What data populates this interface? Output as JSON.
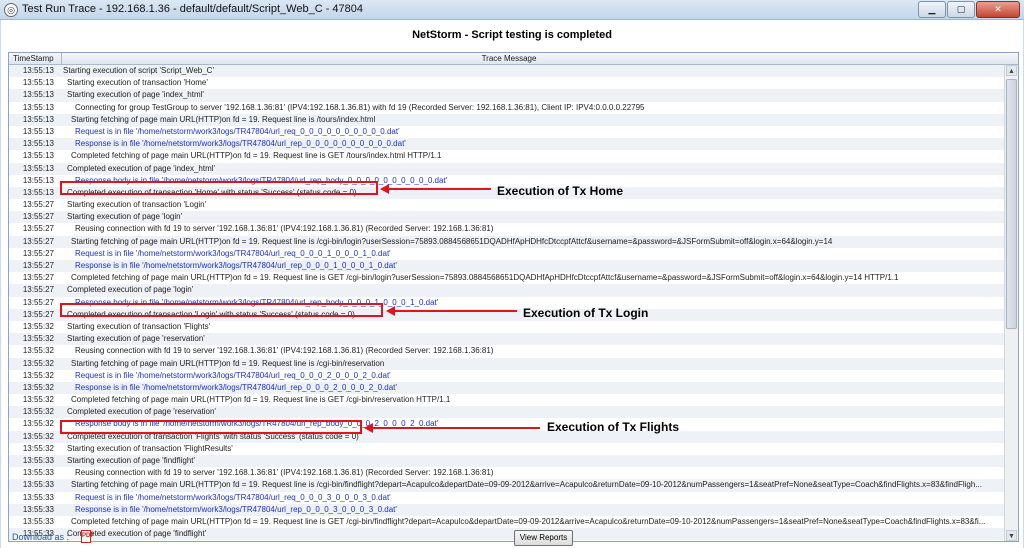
{
  "window": {
    "title": "Test Run Trace - 192.168.1.36 - default/default/Script_Web_C - 47804",
    "app_icon": "globe-icon",
    "controls": [
      "minimize-icon",
      "maximize-icon",
      "close-icon"
    ]
  },
  "heading": "NetStorm  -  Script testing is completed",
  "table": {
    "columns": {
      "timestamp": "TimeStamp",
      "message": "Trace Message"
    },
    "rows": [
      {
        "time": "13:55:13",
        "msg": "Starting execution of script 'Script_Web_C'",
        "indent": 0,
        "blue": false
      },
      {
        "time": "13:55:13",
        "msg": "Starting execution of transaction 'Home'",
        "indent": 1,
        "blue": false
      },
      {
        "time": "13:55:13",
        "msg": "Starting execution of page 'index_html'",
        "indent": 1,
        "blue": false
      },
      {
        "time": "13:55:13",
        "msg": "Connecting for group TestGroup to server '192.168.1.36:81' (IPV4:192.168.1.36.81) with fd 19 (Recorded Server: 192.168.1.36:81), Client IP: IPV4:0.0.0.0.22795",
        "indent": 3,
        "blue": false
      },
      {
        "time": "13:55:13",
        "msg": "Starting fetching of page main URL(HTTP)on fd = 19. Request line is /tours/index.html",
        "indent": 2,
        "blue": false
      },
      {
        "time": "13:55:13",
        "msg": "Request is in file '/home/netstorm/work3/logs/TR47804/url_req_0_0_0_0_0_0_0_0_0_0.dat'",
        "indent": 3,
        "blue": true
      },
      {
        "time": "13:55:13",
        "msg": "Response is in file '/home/netstorm/work3/logs/TR47804/url_rep_0_0_0_0_0_0_0_0_0_0.dat'",
        "indent": 3,
        "blue": true
      },
      {
        "time": "13:55:13",
        "msg": "Completed fetching of page main URL(HTTP)on fd = 19. Request line is GET /tours/index.html HTTP/1.1",
        "indent": 2,
        "blue": false
      },
      {
        "time": "13:55:13",
        "msg": "Completed execution of page 'index_html'",
        "indent": 1,
        "blue": false
      },
      {
        "time": "13:55:13",
        "msg": "Response body is in file '/home/netstorm/work3/logs/TR47804/url_rep_body_0_0_0_0_0_0_0_0_0_0.dat'",
        "indent": 3,
        "blue": true
      },
      {
        "time": "13:55:13",
        "msg": "Completed execution of transaction 'Home' with status 'Success' (status code = 0)",
        "indent": 1,
        "blue": false
      },
      {
        "time": "13:55:27",
        "msg": "Starting execution of transaction 'Login'",
        "indent": 1,
        "blue": false
      },
      {
        "time": "13:55:27",
        "msg": "Starting execution of page 'login'",
        "indent": 1,
        "blue": false
      },
      {
        "time": "13:55:27",
        "msg": "Reusing connection with fd 19 to server '192.168.1.36:81' (IPV4:192.168.1.36.81) (Recorded Server: 192.168.1.36:81)",
        "indent": 3,
        "blue": false
      },
      {
        "time": "13:55:27",
        "msg": "Starting fetching of page main URL(HTTP)on fd = 19. Request line is /cgi-bin/login?userSession=75893.0884568651DQADHfApHDHfcDtccpfAttcf&username=&password=&JSFormSubmit=off&login.x=64&login.y=14",
        "indent": 2,
        "blue": false
      },
      {
        "time": "13:55:27",
        "msg": "Request is in file '/home/netstorm/work3/logs/TR47804/url_req_0_0_0_1_0_0_0_1_0.dat'",
        "indent": 3,
        "blue": true
      },
      {
        "time": "13:55:27",
        "msg": "Response is in file '/home/netstorm/work3/logs/TR47804/url_rep_0_0_0_1_0_0_0_1_0.dat'",
        "indent": 3,
        "blue": true
      },
      {
        "time": "13:55:27",
        "msg": "Completed fetching of page main URL(HTTP)on fd = 19. Request line is GET /cgi-bin/login?userSession=75893.0884568651DQADHfApHDHfcDtccpfAttcf&username=&password=&JSFormSubmit=off&login.x=64&login.y=14 HTTP/1.1",
        "indent": 2,
        "blue": false
      },
      {
        "time": "13:55:27",
        "msg": "Completed execution of page 'login'",
        "indent": 1,
        "blue": false
      },
      {
        "time": "13:55:27",
        "msg": "Response body is in file '/home/netstorm/work3/logs/TR47804/url_rep_body_0_0_0_1_0_0_0_1_0.dat'",
        "indent": 3,
        "blue": true
      },
      {
        "time": "13:55:27",
        "msg": "Completed execution of transaction 'Login' with status 'Success' (status code = 0)",
        "indent": 1,
        "blue": false
      },
      {
        "time": "13:55:32",
        "msg": "Starting execution of transaction 'Flights'",
        "indent": 1,
        "blue": false
      },
      {
        "time": "13:55:32",
        "msg": "Starting execution of page 'reservation'",
        "indent": 1,
        "blue": false
      },
      {
        "time": "13:55:32",
        "msg": "Reusing connection with fd 19 to server '192.168.1.36:81' (IPV4:192.168.1.36.81) (Recorded Server: 192.168.1.36:81)",
        "indent": 3,
        "blue": false
      },
      {
        "time": "13:55:32",
        "msg": "Starting fetching of page main URL(HTTP)on fd = 19. Request line is /cgi-bin/reservation",
        "indent": 2,
        "blue": false
      },
      {
        "time": "13:55:32",
        "msg": "Request is in file '/home/netstorm/work3/logs/TR47804/url_req_0_0_0_2_0_0_0_2_0.dat'",
        "indent": 3,
        "blue": true
      },
      {
        "time": "13:55:32",
        "msg": "Response is in file '/home/netstorm/work3/logs/TR47804/url_rep_0_0_0_2_0_0_0_2_0.dat'",
        "indent": 3,
        "blue": true
      },
      {
        "time": "13:55:32",
        "msg": "Completed fetching of page main URL(HTTP)on fd = 19. Request line is GET /cgi-bin/reservation HTTP/1.1",
        "indent": 2,
        "blue": false
      },
      {
        "time": "13:55:32",
        "msg": "Completed execution of page 'reservation'",
        "indent": 1,
        "blue": false
      },
      {
        "time": "13:55:32",
        "msg": "Response body is in file '/home/netstorm/work3/logs/TR47804/url_rep_body_0_0_0_2_0_0_0_2_0.dat'",
        "indent": 3,
        "blue": true
      },
      {
        "time": "13:55:32",
        "msg": "Completed execution of transaction 'Flights' with status 'Success' (status code = 0)",
        "indent": 1,
        "blue": false
      },
      {
        "time": "13:55:32",
        "msg": "Starting execution of transaction 'FlightResults'",
        "indent": 1,
        "blue": false
      },
      {
        "time": "13:55:33",
        "msg": "Starting execution of page 'findflight'",
        "indent": 1,
        "blue": false
      },
      {
        "time": "13:55:33",
        "msg": "Reusing connection with fd 19 to server '192.168.1.36:81' (IPV4:192.168.1.36.81) (Recorded Server: 192.168.1.36:81)",
        "indent": 3,
        "blue": false
      },
      {
        "time": "13:55:33",
        "msg": "Starting fetching of page main URL(HTTP)on fd = 19. Request line is /cgi-bin/findflight?depart=Acapulco&departDate=09-09-2012&arrive=Acapulco&returnDate=09-10-2012&numPassengers=1&seatPref=None&seatType=Coach&findFlights.x=83&findFligh...",
        "indent": 2,
        "blue": false
      },
      {
        "time": "13:55:33",
        "msg": "Request is in file '/home/netstorm/work3/logs/TR47804/url_req_0_0_0_3_0_0_0_3_0.dat'",
        "indent": 3,
        "blue": true
      },
      {
        "time": "13:55:33",
        "msg": "Response is in file '/home/netstorm/work3/logs/TR47804/url_rep_0_0_0_3_0_0_0_3_0.dat'",
        "indent": 3,
        "blue": true
      },
      {
        "time": "13:55:33",
        "msg": "Completed fetching of page main URL(HTTP)on fd = 19. Request line is GET /cgi-bin/findflight?depart=Acapulco&departDate=09-09-2012&arrive=Acapulco&returnDate=09-10-2012&numPassengers=1&seatPref=None&seatType=Coach&findFlights.x=83&fi...",
        "indent": 2,
        "blue": false
      },
      {
        "time": "13:55:33",
        "msg": "Completed execution of page 'findflight'",
        "indent": 1,
        "blue": false
      }
    ]
  },
  "annotations": {
    "home": "Execution of Tx Home",
    "login": "Execution of Tx Login",
    "flights": "Execution of Tx Flights"
  },
  "footer": {
    "download_label": "Download as :",
    "pdf_icon": "pdf-icon",
    "pdf_icon_glyph": "PDF",
    "view_reports_label": "View Reports"
  },
  "colors": {
    "link_blue": "#1c2fd1",
    "highlight_red": "#e0141c"
  }
}
